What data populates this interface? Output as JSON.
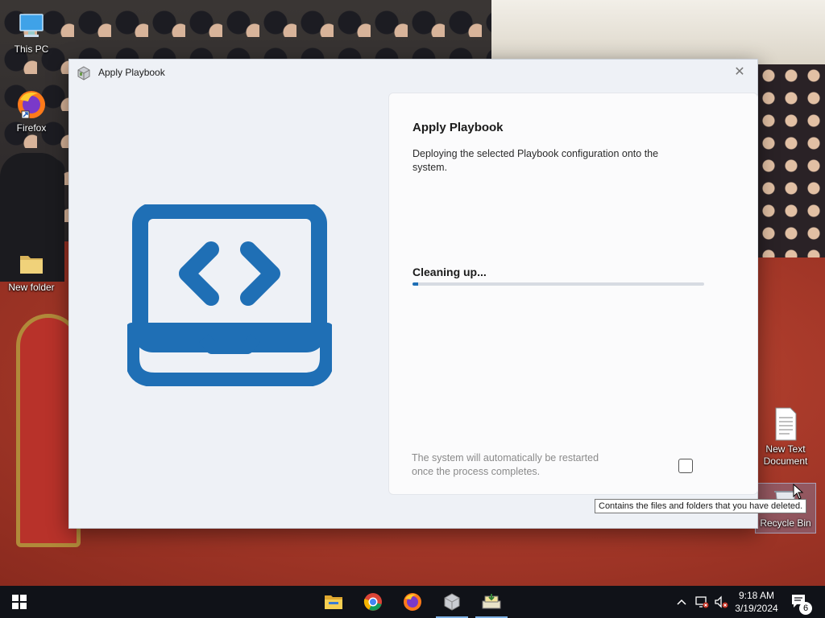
{
  "desktop": {
    "icons": [
      {
        "label": "This PC",
        "icon": "computer-icon"
      },
      {
        "label": "Firefox",
        "icon": "firefox-icon"
      },
      {
        "label": "New folder",
        "icon": "folder-icon"
      },
      {
        "label": "New Text Document",
        "icon": "text-document-icon"
      },
      {
        "label": "Recycle Bin",
        "icon": "recycle-bin-icon"
      }
    ],
    "tooltip": "Contains the files and folders that you have deleted."
  },
  "window": {
    "title": "Apply Playbook",
    "close_glyph": "✕",
    "hero_icon": "laptop-code-icon",
    "accent_color": "#1f6fb5",
    "card": {
      "heading": "Apply Playbook",
      "description": "Deploying the selected Playbook configuration onto the system.",
      "status": "Cleaning up...",
      "progress_fraction": 0.02,
      "note": "The system will automatically be restarted once the process completes.",
      "restart_checkbox_checked": false
    }
  },
  "taskbar": {
    "start_icon": "windows-start-icon",
    "pinned": [
      {
        "name": "File Explorer",
        "icon": "folder-icon",
        "active": false
      },
      {
        "name": "Google Chrome",
        "icon": "chrome-icon",
        "active": false
      },
      {
        "name": "Firefox",
        "icon": "firefox-icon",
        "active": false
      },
      {
        "name": "Playbook app",
        "icon": "cube-app-icon",
        "active": true
      },
      {
        "name": "Installer",
        "icon": "installer-icon",
        "active": true
      }
    ],
    "tray": {
      "chevron": "^",
      "time": "9:18 AM",
      "date": "3/19/2024",
      "notification_count": "6"
    }
  }
}
